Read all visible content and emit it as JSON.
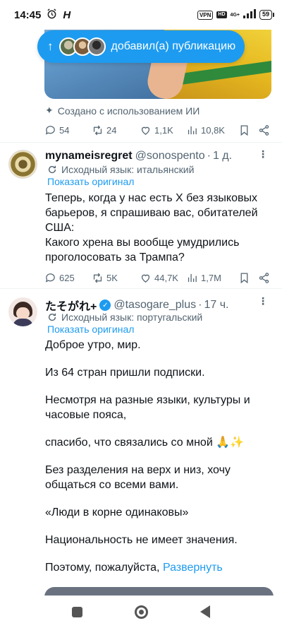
{
  "status_bar": {
    "time": "14:45",
    "vpn": "VPN",
    "network": "4G+",
    "battery": "59"
  },
  "pill": {
    "arrow": "↑",
    "text": "добавил(а) публикацию"
  },
  "post0": {
    "ai_note": "Создано с использованием ИИ",
    "replies": "54",
    "reposts": "24",
    "likes": "1,1K",
    "views": "10,8K"
  },
  "post1": {
    "name": "mynameisregret",
    "handle": "@sonospento",
    "time": "1 д.",
    "translated_from": "Исходный язык: итальянский",
    "show_original": "Показать оригинал",
    "text": [
      "Теперь, когда у нас есть X без языковых барьеров, я спрашиваю вас, обитателей США:",
      "Какого хрена вы вообще умудрились проголосовать за Трампа?"
    ],
    "replies": "625",
    "reposts": "5K",
    "likes": "44,7K",
    "views": "1,7M"
  },
  "post2": {
    "name": "たそがれ+",
    "handle": "@tasogare_plus",
    "time": "17 ч.",
    "translated_from": "Исходный язык: португальский",
    "show_original": "Показать оригинал",
    "text": [
      "Доброе утро, мир.",
      "Из 64 стран пришли подписки.",
      "Несмотря на разные языки, культуры и часовые пояса,",
      "спасибо, что связались со мной 🙏✨",
      "Без разделения на верх и низ, хочу общаться со всеми вами.",
      "«Люди в корне одинаковы»",
      "Национальность не имеет значения.",
      "Поэтому, пожалуйста,"
    ],
    "expand": "Развернуть"
  },
  "colors": {
    "accent": "#1d9bf0",
    "secondary_text": "#536471"
  }
}
